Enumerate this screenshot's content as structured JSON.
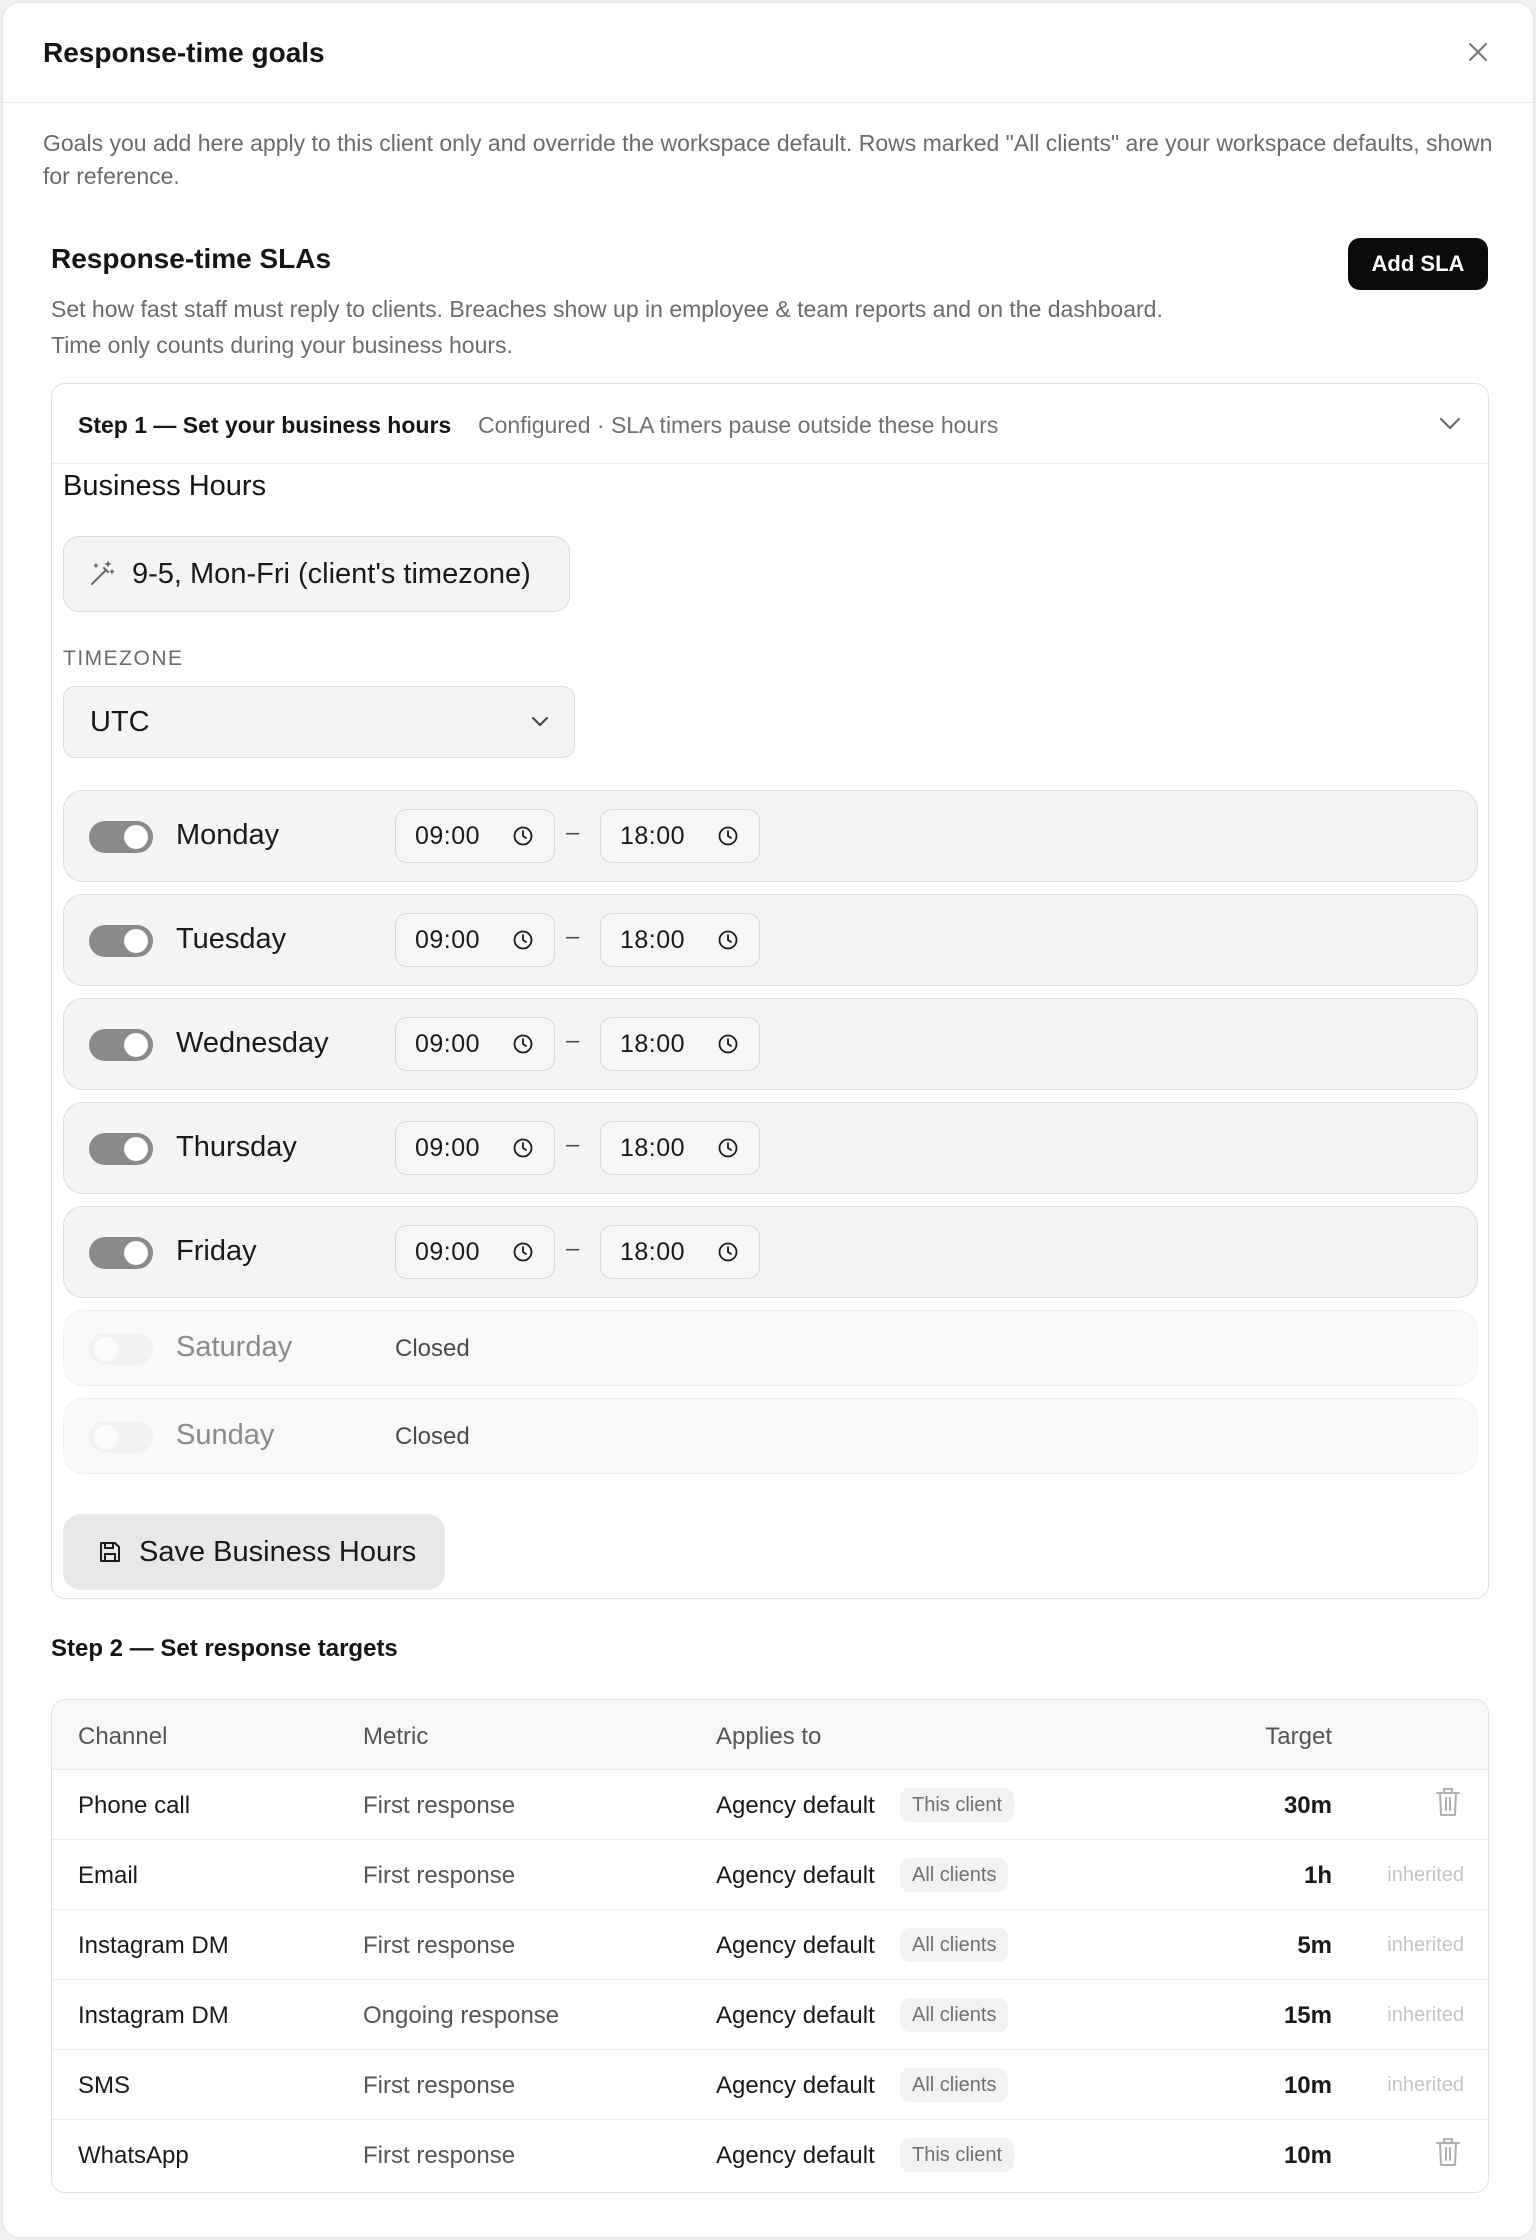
{
  "modal": {
    "title": "Response-time goals",
    "intro": "Goals you add here apply to this client only and override the workspace default. Rows marked \"All clients\" are your workspace defaults, shown for reference."
  },
  "sla": {
    "title": "Response-time SLAs",
    "add_label": "Add SLA",
    "description": "Set how fast staff must reply to clients. Breaches show up in employee & team reports and on the dashboard. Time only counts during your business hours."
  },
  "step1": {
    "title": "Step 1 — Set your business hours",
    "subtitle": "Configured · SLA timers pause outside these hours",
    "business_hours_title": "Business Hours",
    "preset_label": "9-5, Mon-Fri (client's timezone)",
    "timezone_label": "TIMEZONE",
    "timezone_value": "UTC",
    "days": [
      {
        "name": "Monday",
        "open": true,
        "start": "09:00",
        "end": "18:00"
      },
      {
        "name": "Tuesday",
        "open": true,
        "start": "09:00",
        "end": "18:00"
      },
      {
        "name": "Wednesday",
        "open": true,
        "start": "09:00",
        "end": "18:00"
      },
      {
        "name": "Thursday",
        "open": true,
        "start": "09:00",
        "end": "18:00"
      },
      {
        "name": "Friday",
        "open": true,
        "start": "09:00",
        "end": "18:00"
      },
      {
        "name": "Saturday",
        "open": false,
        "status": "Closed"
      },
      {
        "name": "Sunday",
        "open": false,
        "status": "Closed"
      }
    ],
    "dash": "–",
    "save_label": "Save Business Hours"
  },
  "step2": {
    "title": "Step 2 — Set response targets",
    "columns": [
      "Channel",
      "Metric",
      "Applies to",
      "Target"
    ],
    "rows": [
      {
        "channel": "Phone call",
        "metric": "First response",
        "applies_to": "Agency default",
        "scope": "This client",
        "target": "30m",
        "status": ""
      },
      {
        "channel": "Email",
        "metric": "First response",
        "applies_to": "Agency default",
        "scope": "All clients",
        "target": "1h",
        "status": "inherited"
      },
      {
        "channel": "Instagram DM",
        "metric": "First response",
        "applies_to": "Agency default",
        "scope": "All clients",
        "target": "5m",
        "status": "inherited"
      },
      {
        "channel": "Instagram DM",
        "metric": "Ongoing response",
        "applies_to": "Agency default",
        "scope": "All clients",
        "target": "15m",
        "status": "inherited"
      },
      {
        "channel": "SMS",
        "metric": "First response",
        "applies_to": "Agency default",
        "scope": "All clients",
        "target": "10m",
        "status": "inherited"
      },
      {
        "channel": "WhatsApp",
        "metric": "First response",
        "applies_to": "Agency default",
        "scope": "This client",
        "target": "10m",
        "status": ""
      }
    ]
  },
  "colors": {
    "primary_button": "#0b0b0b",
    "toggle_on": "#8a8a8a",
    "toggle_off": "#f1f1f1",
    "muted_text": "#6b6b6b"
  },
  "icons": {
    "close": "close-icon",
    "chevron": "chevron-down-icon",
    "preset": "magic-wand-icon",
    "time": "clock-icon",
    "save": "save-icon",
    "delete": "trash-icon"
  }
}
